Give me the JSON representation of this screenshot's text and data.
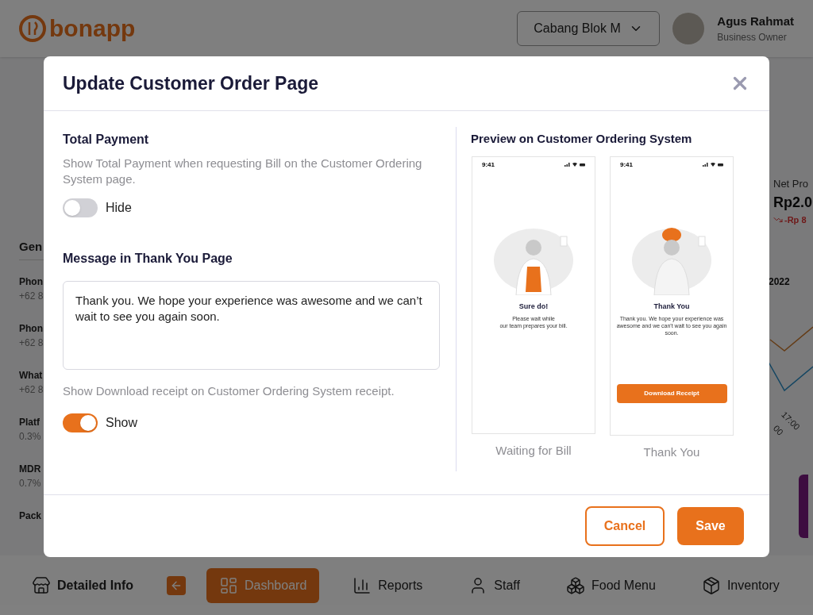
{
  "header": {
    "logo": "bonapp",
    "branch": "Cabang Blok M",
    "user": {
      "name": "Agus Rahmat",
      "role": "Business Owner"
    }
  },
  "background": {
    "left_section": {
      "title": "Gen",
      "items": [
        {
          "label": "Phon",
          "value": "+62 8"
        },
        {
          "label": "Phon",
          "value": "+62 8"
        },
        {
          "label": "What",
          "value": "+62 8"
        },
        {
          "label": "Platf",
          "value": "0.3%"
        },
        {
          "label": "MDR",
          "value": "0.7%"
        },
        {
          "label": "Pack"
        }
      ]
    },
    "right_section": {
      "metric_label": "Net Pro",
      "metric_value": "Rp2.0",
      "metric_change": "-Rp 8",
      "tooltip_year": "2022",
      "axis_labels": [
        "00",
        "17:00"
      ]
    }
  },
  "modal": {
    "title": "Update Customer Order Page",
    "total_payment": {
      "heading": "Total Payment",
      "description": "Show Total Payment when requesting Bill on the Customer Ordering System page.",
      "toggle": {
        "on": false,
        "label": "Hide"
      }
    },
    "thank_you": {
      "heading": "Message in Thank You Page",
      "message": "Thank you. We hope your experience was awesome and we can’t wait to see you again soon."
    },
    "download": {
      "description": "Show Download receipt on Customer Ordering System receipt.",
      "toggle": {
        "on": true,
        "label": "Show"
      }
    },
    "preview": {
      "heading": "Preview on Customer Ordering System",
      "screens": [
        {
          "kind": "waiting",
          "time": "9:41",
          "title": "Sure do!",
          "text": "Please wait while\nour team prepares your bill.",
          "caption": "Waiting for Bill"
        },
        {
          "kind": "thanks",
          "time": "9:41",
          "title": "Thank You",
          "text": "Thank you. We hope your experience was awesome and we can't wait to see you again soon.",
          "button": "Download Receipt",
          "caption": "Thank You"
        }
      ]
    },
    "buttons": {
      "cancel": "Cancel",
      "save": "Save"
    }
  },
  "bottom_nav": [
    {
      "kind": "item",
      "label": "Detailed Info",
      "selected": false
    },
    {
      "kind": "collapse"
    },
    {
      "kind": "item",
      "label": "Dashboard",
      "selected": true
    },
    {
      "kind": "item",
      "label": "Reports",
      "selected": false
    },
    {
      "kind": "item",
      "label": "Staff",
      "selected": false
    },
    {
      "kind": "item",
      "label": "Food Menu",
      "selected": false
    },
    {
      "kind": "item",
      "label": "Inventory",
      "selected": false
    }
  ]
}
